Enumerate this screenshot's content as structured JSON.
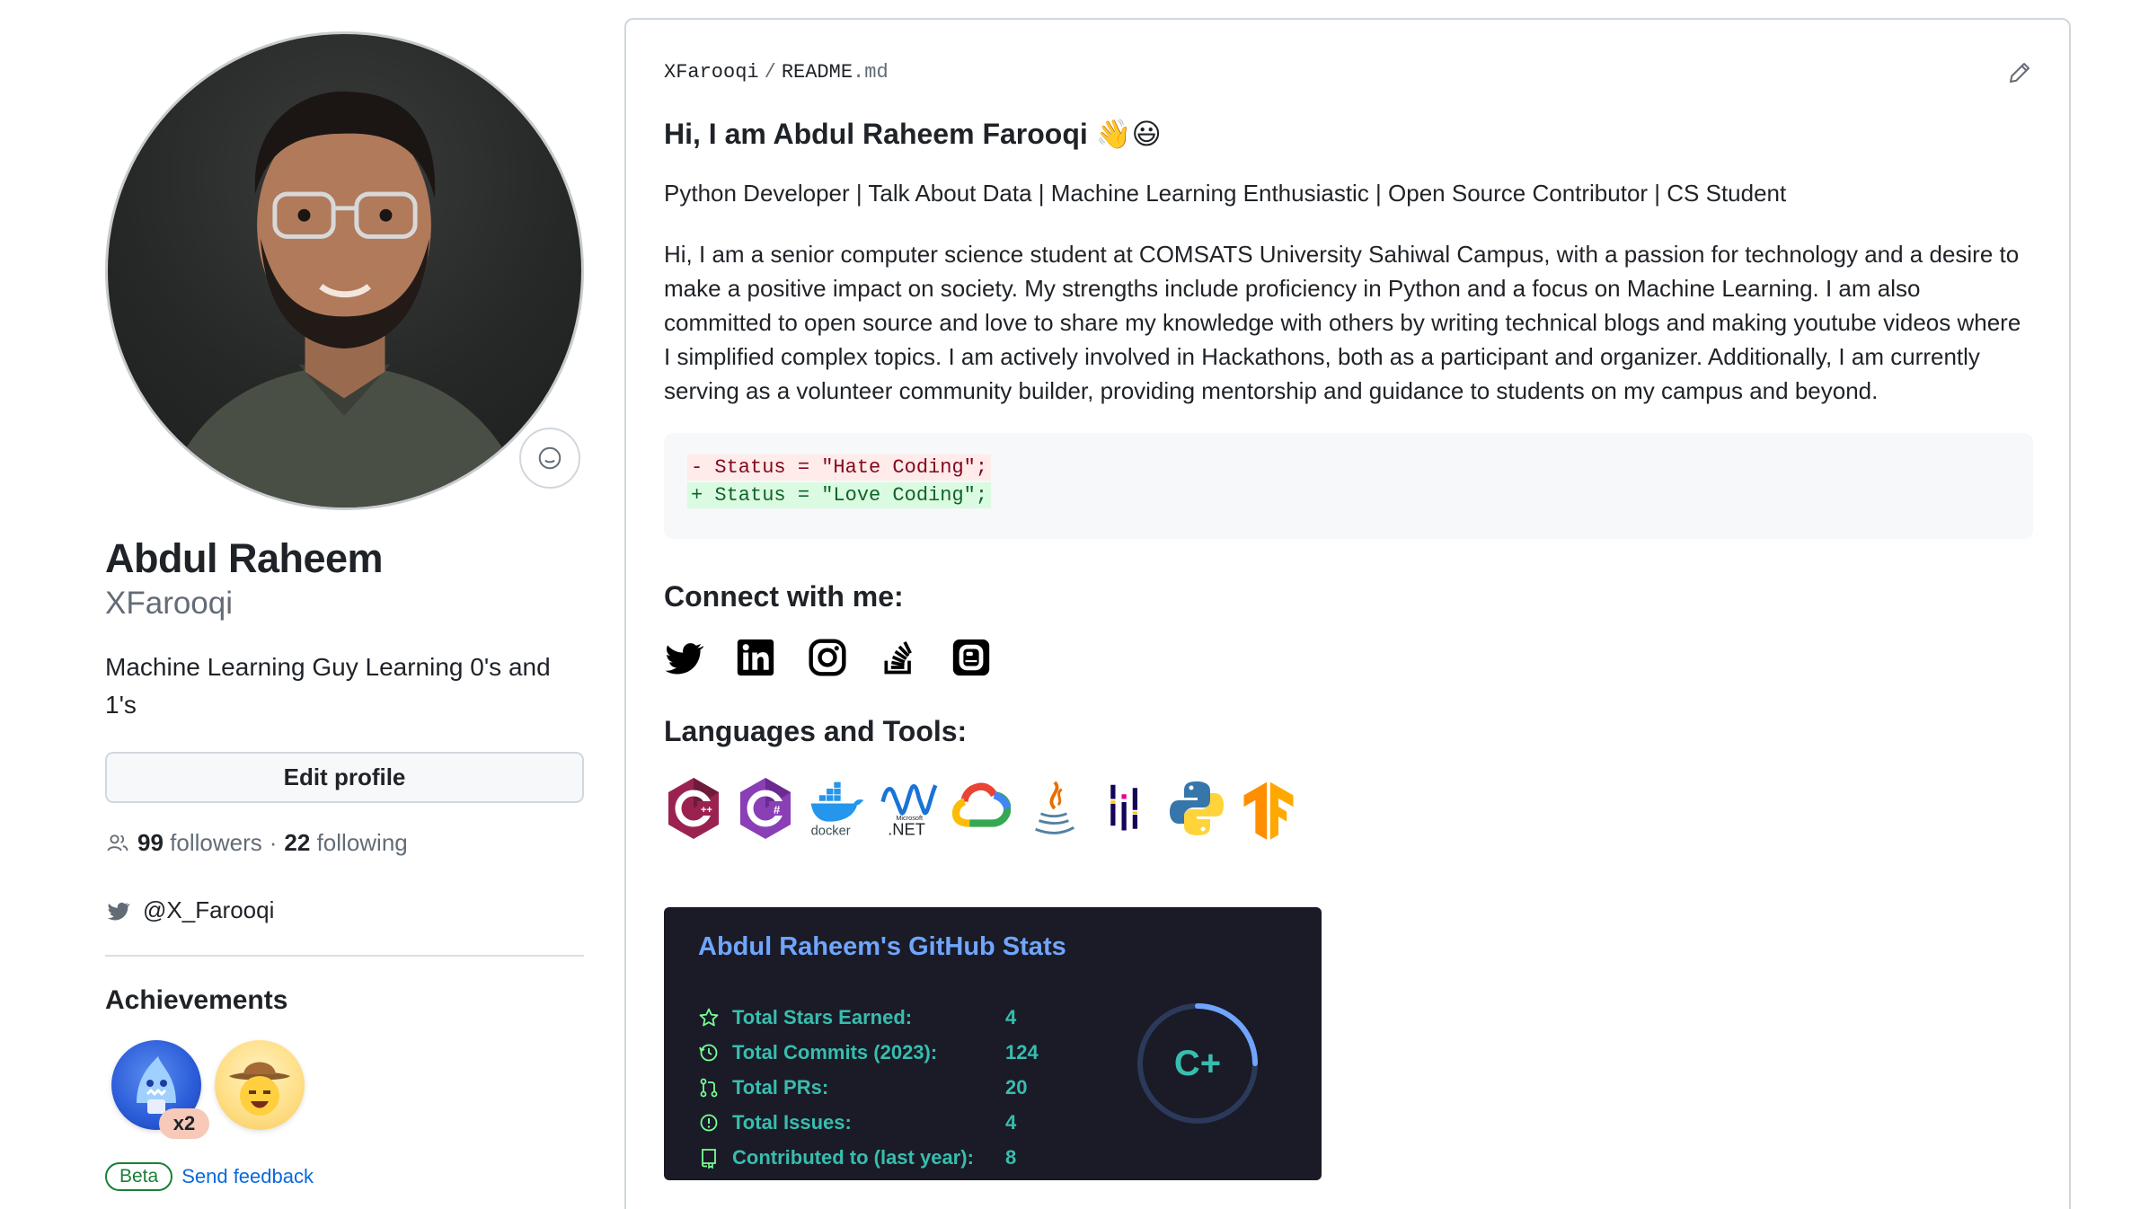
{
  "profile": {
    "full_name": "Abdul Raheem",
    "login": "XFarooqi",
    "bio": "Machine Learning Guy Learning 0's and 1's",
    "edit_label": "Edit profile",
    "followers_count": "99",
    "followers_label": "followers",
    "dot": "·",
    "following_count": "22",
    "following_label": "following",
    "twitter": "@X_Farooqi"
  },
  "achievements": {
    "title": "Achievements",
    "items": [
      {
        "name": "achievement-shark-icon",
        "count": "x2"
      },
      {
        "name": "achievement-cowboy-icon"
      }
    ],
    "beta_label": "Beta",
    "feedback_label": "Send feedback"
  },
  "readme": {
    "owner": "XFarooqi",
    "separator": "/",
    "file_base": "README",
    "file_ext": ".md",
    "heading": "Hi, I am Abdul Raheem Farooqi 👋😃",
    "tagline": "Python Developer | Talk About Data | Machine Learning Enthusiastic | Open Source Contributor | CS Student",
    "about": "Hi, I am a senior computer science student at COMSATS University Sahiwal Campus, with a passion for technology and a desire to make a positive impact on society. My strengths include proficiency in Python and a focus on Machine Learning. I am also committed to open source and love to share my knowledge with others by writing technical blogs and making youtube videos where I simplified complex topics. I am actively involved in Hackathons, both as a participant and organizer. Additionally, I am currently serving as a volunteer community builder, providing mentorship and guidance to students on my campus and beyond.",
    "diff_removed": "- Status = \"Hate Coding\";",
    "diff_added": "+ Status = \"Love Coding\";",
    "connect_heading": "Connect with me:",
    "social_icons": [
      "twitter-icon",
      "linkedin-icon",
      "instagram-icon",
      "stackoverflow-icon",
      "blogger-icon"
    ],
    "tools_heading": "Languages and Tools:",
    "tools": [
      "cplusplus-icon",
      "csharp-icon",
      "docker-icon",
      "dotnet-icon",
      "gcp-icon",
      "java-icon",
      "pandas-icon",
      "python-icon",
      "tensorflow-icon"
    ],
    "docker_text": "docker",
    "dotnet_small": "Microsoft",
    "dotnet_text": ".NET"
  },
  "stats": {
    "title": "Abdul Raheem's GitHub Stats",
    "rows": [
      {
        "icon": "star-icon",
        "label": "Total Stars Earned:",
        "value": "4"
      },
      {
        "icon": "history-icon",
        "label": "Total Commits (2023):",
        "value": "124"
      },
      {
        "icon": "pull-request-icon",
        "label": "Total PRs:",
        "value": "20"
      },
      {
        "icon": "issue-icon",
        "label": "Total Issues:",
        "value": "4"
      },
      {
        "icon": "repo-icon",
        "label": "Contributed to (last year):",
        "value": "8"
      }
    ],
    "grade": "C+",
    "colors": {
      "bg": "#1a1b27",
      "title": "#70a5fd",
      "text": "#38bdae"
    }
  }
}
